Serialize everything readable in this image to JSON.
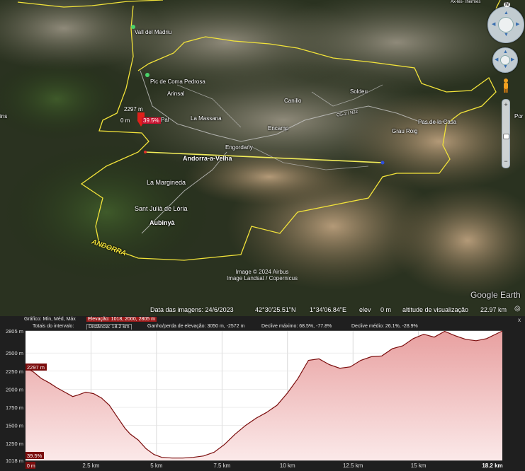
{
  "map": {
    "places": [
      {
        "id": "vall-del-madriu",
        "text": "Vall del Madriu"
      },
      {
        "id": "pic-de-coma-pedrosa",
        "text": "Pic de Coma Pedrosa"
      },
      {
        "id": "arinsal",
        "text": "Arinsal"
      },
      {
        "id": "canillo",
        "text": "Canillo"
      },
      {
        "id": "soldeu",
        "text": "Soldeu"
      },
      {
        "id": "la-massana",
        "text": "La Massana"
      },
      {
        "id": "encamp",
        "text": "Encamp"
      },
      {
        "id": "pal",
        "text": "Pal"
      },
      {
        "id": "engordany",
        "text": "Engordany"
      },
      {
        "id": "andorra-la-vella",
        "text": "Andorra-a-Velha"
      },
      {
        "id": "pas-de-la-casa",
        "text": "Pas de la Casa"
      },
      {
        "id": "grau-roig",
        "text": "Grau Roig"
      },
      {
        "id": "la-margineda",
        "text": "La Margineda"
      },
      {
        "id": "sant-julia",
        "text": "Sant Julià de Lòria"
      },
      {
        "id": "aubinya",
        "text": "Aubinyà"
      },
      {
        "id": "andorra",
        "text": "ANDORRA"
      },
      {
        "id": "ax-les-thermes",
        "text": "Ax-les-Thermes"
      },
      {
        "id": "ins",
        "text": "ins"
      },
      {
        "id": "por",
        "text": "Por"
      },
      {
        "id": "road",
        "text": "CG-2 / N22"
      }
    ],
    "marker": {
      "elevation": "2297 m",
      "distance": "0 m",
      "slope": "39.5%"
    },
    "credits": {
      "line1": "Image © 2024 Airbus",
      "line2": "Image Landsat / Copernicus"
    },
    "logo": "Google Earth",
    "status": {
      "date_label": "Data das imagens: 24/6/2023",
      "lat": "42°30'25.51\"N",
      "lon": "1°34'06.84\"E",
      "elev_label": "elev",
      "elev_value": "0 m",
      "view_label": "altitude de visualização",
      "view_value": "22.97 km"
    },
    "controls": {
      "north": "N",
      "zoom_in": "+",
      "zoom_out": "−"
    }
  },
  "profile": {
    "header1": {
      "label": "Gráfico: Mín, Méd, Máx",
      "highlight": "Elevação: 1018, 2000, 2805 m"
    },
    "header2": {
      "totals": "Totais do intervalo:",
      "distance": "Distância: 18.2 km",
      "gain": "Ganho/perda de elevação: 3050 m, -2572 m",
      "max_slope": "Declive máximo: 68.5%, -77.8%",
      "avg_slope": "Declive médio: 26.1%, -28.9%"
    },
    "close": "x",
    "colors": {
      "line": "#7b0d0d",
      "fill_top": "#e8a0a0",
      "fill_bottom": "#fbe9e9",
      "badge": "#7b0d0d"
    }
  },
  "chart_data": {
    "type": "area",
    "xlabel": "",
    "ylabel": "",
    "x_ticks": [
      "2.5 km",
      "5 km",
      "7.5 km",
      "10 km",
      "12.5 km",
      "15 km"
    ],
    "x_end_label": "18.2 km",
    "x_start_label": "0 m",
    "y_ticks": [
      "2805 m",
      "2500 m",
      "2250 m",
      "2000 m",
      "1750 m",
      "1500 m",
      "1250 m",
      "1018 m"
    ],
    "cursor": {
      "elevation_label": "2297 m",
      "slope_label": "39.5%"
    },
    "ylim": [
      1018,
      2805
    ],
    "xlim": [
      0,
      18.2
    ],
    "series": [
      {
        "x": [
          0,
          0.3,
          0.6,
          0.9,
          1.2,
          1.5,
          1.8,
          2.0,
          2.3,
          2.6,
          2.9,
          3.2,
          3.5,
          3.8,
          4.0,
          4.3,
          4.6,
          4.9,
          5.2,
          5.6,
          6.0,
          6.4,
          6.8,
          7.2,
          7.6,
          8.0,
          8.4,
          8.8,
          9.2,
          9.6,
          10.0,
          10.4,
          10.8,
          11.2,
          11.6,
          12.0,
          12.4,
          12.8,
          13.2,
          13.6,
          14.0,
          14.4,
          14.8,
          15.2,
          15.6,
          16.0,
          16.4,
          16.8,
          17.2,
          17.6,
          18.2
        ],
        "y": [
          2297,
          2240,
          2150,
          2090,
          2020,
          1960,
          1900,
          1920,
          1960,
          1940,
          1880,
          1780,
          1620,
          1460,
          1380,
          1300,
          1180,
          1100,
          1060,
          1050,
          1050,
          1060,
          1080,
          1130,
          1240,
          1380,
          1500,
          1600,
          1680,
          1780,
          1950,
          2150,
          2400,
          2420,
          2340,
          2290,
          2310,
          2400,
          2450,
          2460,
          2560,
          2600,
          2700,
          2760,
          2720,
          2800,
          2740,
          2690,
          2670,
          2700,
          2805
        ]
      }
    ]
  }
}
